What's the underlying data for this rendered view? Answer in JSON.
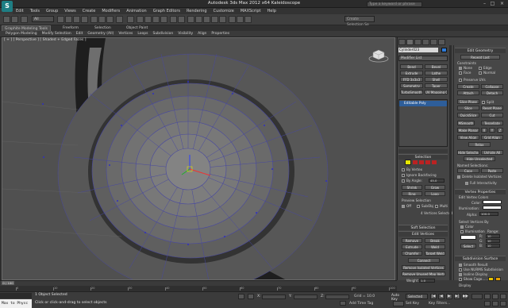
{
  "window": {
    "title": "Autodesk 3ds Max 2012 x64",
    "filename": "Kaleidoscope",
    "search_placeholder": "Type a keyword or phrase"
  },
  "menu": [
    "Edit",
    "Tools",
    "Group",
    "Views",
    "Create",
    "Modifiers",
    "Animation",
    "Graph Editors",
    "Rendering",
    "Customize",
    "MAXScript",
    "Help"
  ],
  "toolbar": {
    "selection_filter": "All",
    "named_selection": "Create Selection Se"
  },
  "ribbon": {
    "tabs": [
      "Graphite Modeling Tools",
      "Freeform",
      "Selection",
      "Object Paint"
    ],
    "panels": [
      "Polygon Modeling",
      "Modify Selection",
      "Edit",
      "Geometry (All)",
      "Vertices",
      "Loops",
      "Subdivision",
      "Visibility",
      "Align",
      "Properties"
    ]
  },
  "viewport": {
    "label": "[ + ] [ Perspective ] [ Shaded + Edged Faces ]"
  },
  "command_panel": {
    "object_name": "Cylinder023",
    "object_color": "#2e7bd9",
    "modifier_list": "Modifier List",
    "modifier_buttons": [
      [
        "Bend",
        "Bevel"
      ],
      [
        "Extrude",
        "Lathe"
      ],
      [
        "FFD 3x3x3",
        "Shell"
      ],
      [
        "Symmetry",
        "Taper"
      ],
      [
        "TurboSmooth",
        "UV Mapping Cla"
      ]
    ],
    "stack_item": "Editable Poly",
    "selection": {
      "title": "Selection",
      "by_vertex": "By Vertex",
      "ignore_backfacing": "Ignore Backfacing",
      "by_angle": "By Angle:",
      "angle_value": "45.0",
      "shrink": "Shrink",
      "grow": "Grow",
      "ring": "Ring",
      "loop": "Loop",
      "preview_selection": "Preview Selection",
      "preview_off": "Off",
      "subobj": "SubObj",
      "multi": "Multi",
      "vertices_selected": "4 Vertices Selected"
    },
    "soft_selection": {
      "title": "Soft Selection"
    },
    "edit_vertices": {
      "title": "Edit Vertices",
      "remove": "Remove",
      "break": "Break",
      "extrude": "Extrude",
      "weld": "Weld",
      "chamfer": "Chamfer",
      "target_weld": "Target Weld",
      "connect": "Connect",
      "remove_isolated": "Remove Isolated Vertices",
      "remove_unused": "Remove Unused Map Verts",
      "weight_label": "Weight:",
      "weight_value": "1.0"
    }
  },
  "right_rollouts": {
    "edit_geometry": {
      "title": "Edit Geometry",
      "repeat_last": "Repeat Last",
      "constraints": "Constraints",
      "none": "None",
      "edge": "Edge",
      "face": "Face",
      "normal": "Normal",
      "preserve_uvs": "Preserve UVs",
      "create": "Create",
      "collapse": "Collapse",
      "attach": "Attach",
      "detach": "Detach",
      "slice_plane": "Slice Plane",
      "split": "Split",
      "slice": "Slice",
      "reset_plane": "Reset Plane",
      "quickslice": "QuickSlice",
      "cut": "Cut",
      "msmooth": "MSmooth",
      "tessellate": "Tessellate",
      "make_planar": "Make Planar",
      "x": "X",
      "y": "Y",
      "z": "Z",
      "view_align": "View Align",
      "grid_align": "Grid Align",
      "relax": "Relax",
      "hide_selected": "Hide Selected",
      "unhide_all": "Unhide All",
      "hide_unselected": "Hide Unselected",
      "named_selections": "Named Selections:",
      "copy": "Copy",
      "paste": "Paste",
      "delete_isolated": "Delete Isolated Vertices",
      "full_interactivity": "Full Interactivity"
    },
    "vertex_properties": {
      "title": "Vertex Properties",
      "edit_vertex_colors": "Edit Vertex Colors",
      "color": "Color:",
      "illumination": "Illumination:",
      "alpha": "Alpha:",
      "alpha_value": "100.0",
      "select_vertices_by": "Select Vertices By",
      "color_opt": "Color",
      "illumination_opt": "Illumination",
      "range": "Range:",
      "r": "R:",
      "g": "G:",
      "b": "B:",
      "range_value": "10",
      "select": "Select"
    },
    "subdivision_surface": {
      "title": "Subdivision Surface",
      "smooth_result": "Smooth Result",
      "use_nurms": "Use NURMS Subdivision",
      "isoline_display": "Isoline Display",
      "show_cage": "Show Cage......",
      "display": "Display"
    }
  },
  "timeline": {
    "counter": "0 / 100",
    "ticks": [
      "0",
      "10",
      "20",
      "30",
      "40",
      "50",
      "60",
      "70",
      "80",
      "90",
      "100"
    ]
  },
  "status": {
    "maxscript": "Max to Physc",
    "message": "1 Object Selected",
    "prompt": "Click or click-and-drag to select objects",
    "x_label": "X:",
    "y_label": "Y:",
    "z_label": "Z:",
    "grid": "Grid = 10.0",
    "add_time_tag": "Add Time Tag",
    "auto_key": "Auto Key",
    "selected": "Selected",
    "set_key": "Set Key",
    "key_filters": "Key Filters..."
  }
}
